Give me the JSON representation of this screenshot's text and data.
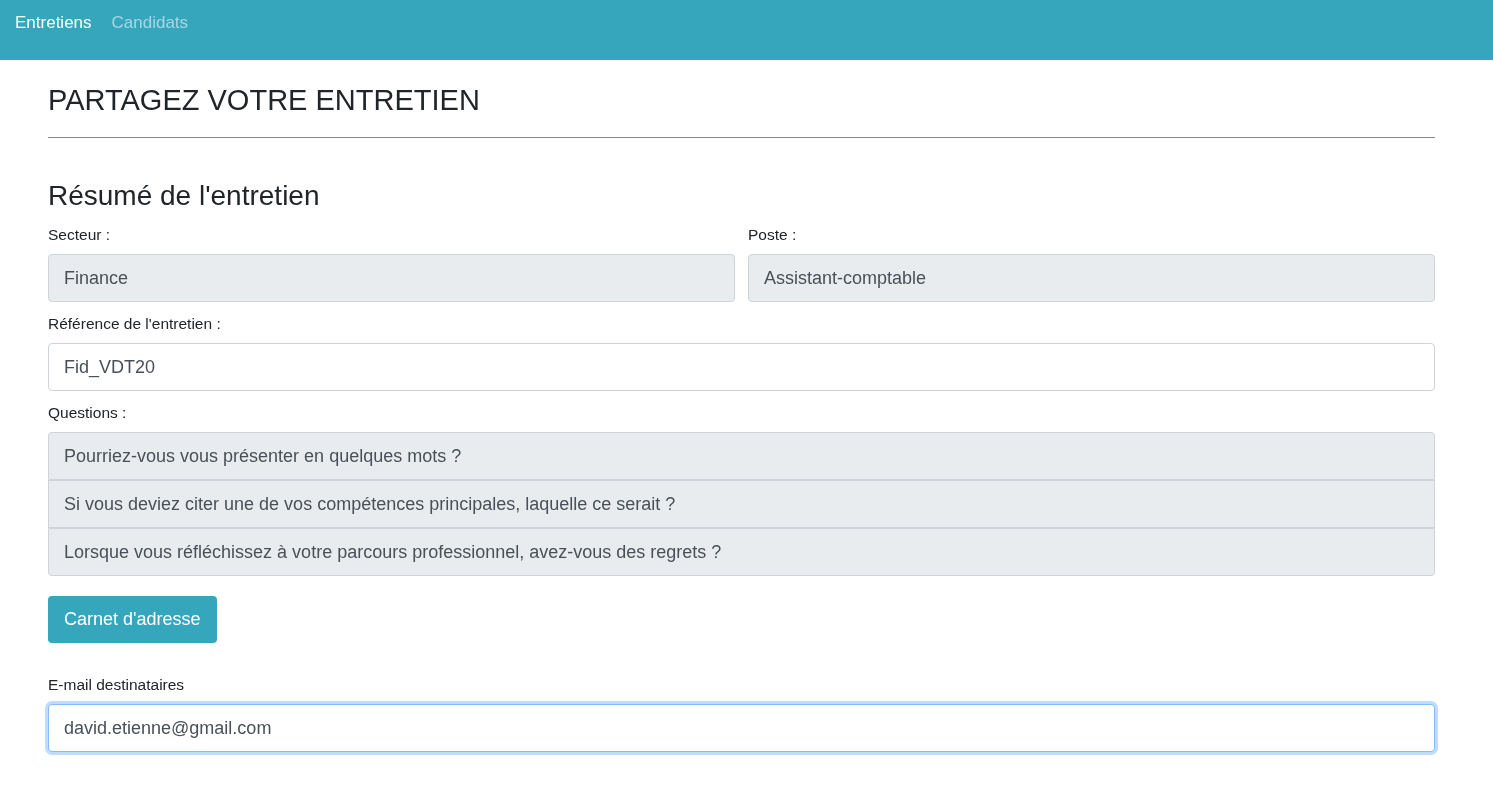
{
  "navbar": {
    "items": [
      {
        "label": "Entretiens",
        "selected": true
      },
      {
        "label": "Candidats",
        "selected": false
      }
    ]
  },
  "page_title": "PARTAGEZ VOTRE ENTRETIEN",
  "section_title": "Résumé de l'entretien",
  "fields_row": [
    {
      "label": "Secteur :",
      "value": "Finance",
      "disabled": true
    },
    {
      "label": "Poste :",
      "value": "Assistant-comptable",
      "disabled": true
    }
  ],
  "reference": {
    "label": "Référence de l'entretien :",
    "value": "Fid_VDT20",
    "disabled": false
  },
  "questions": {
    "label": "Questions :",
    "items": [
      {
        "value": "Pourriez-vous vous présenter en quelques mots ?",
        "disabled": true
      },
      {
        "value": "Si vous deviez citer une de vos compétences principales, laquelle ce serait ?",
        "disabled": true
      },
      {
        "value": "Lorsque vous réfléchissez à votre parcours professionnel, avez-vous des regrets ?",
        "disabled": true
      }
    ]
  },
  "address_book_button": "Carnet d'adresse",
  "email": {
    "label": "E-mail destinataires",
    "value": "david.etienne@gmail.com",
    "focused": true
  }
}
